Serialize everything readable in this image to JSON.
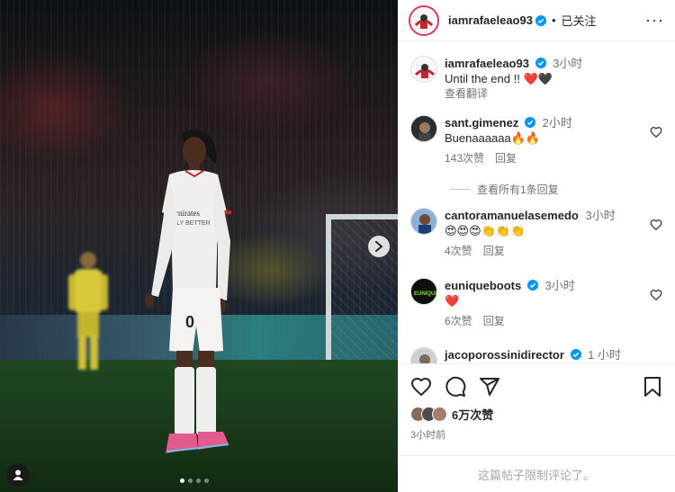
{
  "post": {
    "author": "iamrafaeleao93",
    "follow_state": "已关注",
    "more_label": "···"
  },
  "caption": {
    "author": "iamrafaeleao93",
    "time": "3小时",
    "text": "Until the end !! ❤️🖤",
    "translate": "查看翻译"
  },
  "comments": [
    {
      "author": "sant.gimenez",
      "verified": true,
      "time": "2小时",
      "text": "Buenaaaaaa🔥🔥",
      "likes": "143次赞",
      "reply": "回复"
    },
    {
      "author": "cantoramanuelasemedo",
      "verified": false,
      "time": "3小时",
      "text": "😍😍😍👏👏👏",
      "likes": "4次赞",
      "reply": "回复"
    },
    {
      "author": "euniqueboots",
      "verified": true,
      "time": "3小时",
      "text": "❤️",
      "likes": "6次赞",
      "reply": "回复"
    },
    {
      "author": "jacoporossinidirector",
      "verified": true,
      "time": "1 小时",
      "text": "",
      "likes": "",
      "reply": ""
    }
  ],
  "view_replies": "查看所有1条回复",
  "likes_total": "6万次赞",
  "posted_ago": "3小时前",
  "comments_limited": "这篇帖子限制评论了。",
  "colors": {
    "verified_blue": "#0095f6",
    "muted_text": "#737373"
  },
  "icons": [
    "heart-icon",
    "comment-icon",
    "share-icon",
    "bookmark-icon",
    "chevron-right-icon",
    "tag-person-icon",
    "more-icon",
    "verified-badge-icon"
  ]
}
